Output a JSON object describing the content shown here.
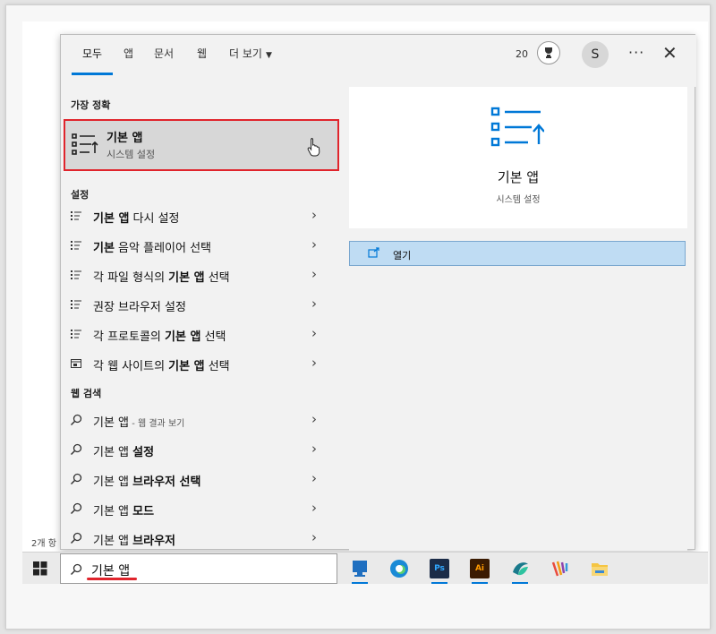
{
  "tabs": [
    {
      "label": "모두",
      "active": true
    },
    {
      "label": "앱"
    },
    {
      "label": "문서"
    },
    {
      "label": "웹"
    },
    {
      "label": "더 보기"
    }
  ],
  "header": {
    "points": "20",
    "avatar_initial": "S",
    "more_label": "···",
    "close_label": "✕"
  },
  "best_match": {
    "heading": "가장 정확",
    "title": "기본 앱",
    "subtitle": "시스템 설정"
  },
  "settings": {
    "heading": "설정",
    "items": [
      {
        "bold": "기본 앱",
        "rest": " 다시 설정",
        "icon": "list-icon"
      },
      {
        "bold": "기본",
        "rest": " 음악 플레이어 선택",
        "icon": "list-icon"
      },
      {
        "pre": "각 파일 형식의 ",
        "bold": "기본 앱",
        "rest": " 선택",
        "icon": "list-icon"
      },
      {
        "pre": "권장 브라우저 설정",
        "icon": "list-icon"
      },
      {
        "pre": "각 프로토콜의 ",
        "bold": "기본 앱",
        "rest": " 선택",
        "icon": "list-icon"
      },
      {
        "pre": "각 웹 사이트의 ",
        "bold": "기본 앱",
        "rest": " 선택",
        "icon": "window-icon"
      }
    ]
  },
  "web": {
    "heading": "웹 검색",
    "items": [
      {
        "pre": "기본 앱",
        "sub": " - 웹 결과 보기"
      },
      {
        "pre": "기본 앱 ",
        "bold": "설정"
      },
      {
        "pre": "기본 앱 ",
        "bold": "브라우저 선택"
      },
      {
        "pre": "기본 앱 ",
        "bold": "모드"
      },
      {
        "pre": "기본 앱 ",
        "bold": "브라우저"
      }
    ]
  },
  "preview": {
    "title": "기본 앱",
    "subtitle": "시스템 설정",
    "open_label": "열기"
  },
  "side_note": "2개 항",
  "taskbar": {
    "search_text": "기본 앱",
    "ps_label": "Ps",
    "ai_label": "Ai"
  },
  "colors": {
    "accent": "#0078d7",
    "highlight": "#e0242c",
    "selected_bg": "#d7d7d7",
    "action_bg": "#bfdcf3"
  }
}
